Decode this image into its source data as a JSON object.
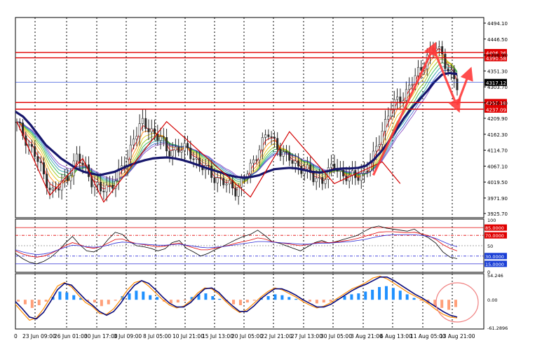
{
  "colors": {
    "background": "#ffffff",
    "grid": "#000000",
    "h_line": "#e00000",
    "h_line_blue": "#1a3fd6",
    "ma_thick": "#16166b",
    "candle": "#2b2b2b",
    "arrow": "#ff3a3a",
    "zigzag": "#d40000",
    "rsi_black": "#000000",
    "rsi_red": "#e00000",
    "rsi_blue": "#2a2ad6",
    "hist_pos": "#1e90ff",
    "hist_neg": "#ffa07a",
    "macd_orange": "#ff8c00",
    "macd_navy": "#0a0a7a",
    "label_blue_bg": "#1a3fd6",
    "label_black_bg": "#000000",
    "label_red_bg": "#e00000"
  },
  "chart_data": [
    {
      "type": "candlestick",
      "panel": "price",
      "yticks": [
        "4494.10",
        "4446.50",
        "4398.90",
        "4351.30",
        "4303.70",
        "4256.10",
        "4209.90",
        "4162.30",
        "4114.70",
        "4067.10",
        "4019.50",
        "3971.90",
        "3925.70"
      ],
      "ylim": [
        3925.7,
        4494.1
      ],
      "close_path": [
        [
          0,
          4190
        ],
        [
          3,
          4150
        ],
        [
          6,
          4100
        ],
        [
          9,
          4040
        ],
        [
          12,
          3990
        ],
        [
          14,
          4000
        ],
        [
          17,
          4040
        ],
        [
          20,
          4090
        ],
        [
          23,
          4060
        ],
        [
          26,
          4010
        ],
        [
          28,
          3990
        ],
        [
          31,
          4010
        ],
        [
          34,
          4040
        ],
        [
          37,
          4090
        ],
        [
          39,
          4160
        ],
        [
          42,
          4190
        ],
        [
          45,
          4175
        ],
        [
          48,
          4150
        ],
        [
          50,
          4110
        ],
        [
          53,
          4120
        ],
        [
          56,
          4115
        ],
        [
          59,
          4100
        ],
        [
          61,
          4070
        ],
        [
          64,
          4050
        ],
        [
          67,
          4030
        ],
        [
          70,
          4010
        ],
        [
          73,
          4000
        ],
        [
          76,
          4030
        ],
        [
          79,
          4080
        ],
        [
          81,
          4130
        ],
        [
          84,
          4160
        ],
        [
          87,
          4130
        ],
        [
          90,
          4090
        ],
        [
          93,
          4075
        ],
        [
          96,
          4060
        ],
        [
          99,
          4030
        ],
        [
          102,
          4030
        ],
        [
          104,
          4045
        ],
        [
          106,
          4070
        ],
        [
          108,
          4050
        ],
        [
          111,
          4030
        ],
        [
          113,
          4035
        ],
        [
          116,
          4050
        ],
        [
          119,
          4090
        ],
        [
          122,
          4180
        ],
        [
          125,
          4240
        ],
        [
          128,
          4270
        ],
        [
          130,
          4290
        ],
        [
          133,
          4330
        ],
        [
          135,
          4360
        ],
        [
          137,
          4400
        ],
        [
          140,
          4420
        ],
        [
          142,
          4400
        ],
        [
          145,
          4340
        ],
        [
          147,
          4300
        ]
      ],
      "n_bars": 148,
      "ma_thick": [
        4230,
        4215,
        4190,
        4160,
        4130,
        4110,
        4090,
        4075,
        4060,
        4050,
        4045,
        4040,
        4045,
        4050,
        4060,
        4070,
        4078,
        4085,
        4090,
        4092,
        4093,
        4090,
        4085,
        4078,
        4070,
        4062,
        4055,
        4048,
        4040,
        4035,
        4032,
        4035,
        4040,
        4050,
        4058,
        4060,
        4062,
        4060,
        4055,
        4050,
        4048,
        4052,
        4058,
        4060,
        4060,
        4062,
        4068,
        4085,
        4110,
        4140,
        4175,
        4210,
        4240,
        4265,
        4290,
        4318,
        4340,
        4345,
        4342
      ],
      "h_lines": [
        {
          "value": 4406.36,
          "label": "4406.36",
          "kind": "red"
        },
        {
          "value": 4390.58,
          "label": "4390.58",
          "kind": "red"
        },
        {
          "value": 4317.12,
          "label": "4317.12",
          "kind": "current"
        },
        {
          "value": 4257.18,
          "label": "4257.18",
          "kind": "red"
        },
        {
          "value": 4237.09,
          "label": "4237.09",
          "kind": "red"
        }
      ],
      "zigzag": [
        [
          0,
          4200
        ],
        [
          11,
          3980
        ],
        [
          22,
          4090
        ],
        [
          29,
          3960
        ],
        [
          50,
          4200
        ],
        [
          78,
          3975
        ],
        [
          91,
          4170
        ],
        [
          106,
          4015
        ],
        [
          122,
          4080
        ],
        [
          128,
          4015
        ]
      ],
      "arrows": [
        {
          "from": [
            119,
            4040
          ],
          "to": [
            139,
            4420
          ]
        },
        {
          "from": [
            139,
            4420
          ],
          "to": [
            147,
            4245
          ]
        },
        {
          "from": [
            147,
            4250
          ],
          "to": [
            151,
            4345
          ]
        }
      ]
    },
    {
      "type": "line",
      "panel": "rsi",
      "ylim": [
        0,
        100
      ],
      "yticks": [
        "100",
        "85.0000",
        "70.0000",
        "50",
        "30.0000",
        "15.0000",
        "0"
      ],
      "levels": [
        {
          "value": 85,
          "label": "85.0000",
          "kind": "red"
        },
        {
          "value": 70,
          "label": "70.0000",
          "kind": "red"
        },
        {
          "value": 50,
          "label": "50",
          "kind": "gray"
        },
        {
          "value": 30,
          "label": "30.0000",
          "kind": "blue"
        },
        {
          "value": 15,
          "label": "15.0000",
          "kind": "blue"
        }
      ],
      "series": [
        {
          "color_key": "rsi_black",
          "values": [
            35,
            25,
            18,
            15,
            20,
            28,
            40,
            55,
            68,
            52,
            40,
            38,
            45,
            62,
            76,
            72,
            58,
            50,
            48,
            45,
            40,
            44,
            56,
            60,
            45,
            38,
            30,
            35,
            42,
            48,
            55,
            62,
            68,
            72,
            80,
            70,
            58,
            55,
            50,
            45,
            40,
            48,
            56,
            60,
            55,
            58,
            62,
            66,
            70,
            78,
            85,
            88,
            84,
            82,
            80,
            78,
            82,
            72,
            65,
            55,
            38,
            28,
            25
          ]
        },
        {
          "color_key": "rsi_red",
          "values": [
            40,
            34,
            30,
            28,
            30,
            35,
            42,
            50,
            56,
            52,
            47,
            45,
            48,
            55,
            62,
            63,
            58,
            54,
            52,
            50,
            48,
            49,
            53,
            55,
            50,
            46,
            42,
            42,
            45,
            48,
            51,
            55,
            58,
            61,
            65,
            63,
            58,
            56,
            54,
            52,
            50,
            52,
            55,
            57,
            56,
            57,
            59,
            61,
            64,
            68,
            72,
            76,
            77,
            77,
            76,
            75,
            76,
            73,
            69,
            62,
            52,
            45,
            40
          ]
        },
        {
          "color_key": "rsi_blue",
          "values": [
            42,
            38,
            35,
            33,
            34,
            37,
            42,
            47,
            51,
            50,
            48,
            47,
            48,
            51,
            55,
            57,
            56,
            54,
            53,
            52,
            51,
            51,
            52,
            53,
            51,
            49,
            47,
            46,
            47,
            48,
            50,
            52,
            54,
            56,
            58,
            58,
            57,
            56,
            55,
            54,
            53,
            53,
            54,
            55,
            55,
            56,
            57,
            58,
            60,
            62,
            65,
            68,
            70,
            71,
            71,
            71,
            71,
            70,
            68,
            64,
            58,
            52,
            48
          ]
        }
      ]
    },
    {
      "type": "bar",
      "panel": "macd",
      "ylim": [
        -61.2896,
        54.246
      ],
      "yticks": [
        "54.246",
        "0.00",
        "-61.2896"
      ],
      "histogram": [
        -4,
        -10,
        -18,
        -12,
        -4,
        6,
        18,
        16,
        10,
        4,
        -4,
        -6,
        -14,
        -10,
        -2,
        8,
        14,
        20,
        18,
        10,
        6,
        -4,
        -8,
        -6,
        -2,
        6,
        12,
        14,
        8,
        2,
        -4,
        -10,
        -12,
        -6,
        -2,
        4,
        8,
        12,
        10,
        6,
        2,
        -2,
        -4,
        -8,
        -6,
        -4,
        2,
        8,
        12,
        14,
        18,
        22,
        28,
        30,
        26,
        20,
        12,
        4,
        -2,
        -8,
        -14,
        -18,
        -22,
        -16
      ],
      "series": [
        {
          "color_key": "macd_orange",
          "values": [
            -10,
            -28,
            -45,
            -40,
            -20,
            5,
            30,
            38,
            28,
            10,
            -6,
            -15,
            -30,
            -32,
            -20,
            0,
            22,
            38,
            42,
            30,
            15,
            0,
            -12,
            -18,
            -14,
            -2,
            15,
            26,
            24,
            12,
            -4,
            -18,
            -28,
            -22,
            -8,
            6,
            18,
            26,
            22,
            14,
            6,
            -4,
            -12,
            -18,
            -14,
            -6,
            4,
            14,
            24,
            30,
            38,
            48,
            52,
            46,
            36,
            26,
            16,
            8,
            0,
            -10,
            -22,
            -32,
            -38,
            -40
          ]
        },
        {
          "color_key": "macd_navy",
          "values": [
            -4,
            -20,
            -38,
            -42,
            -28,
            -4,
            22,
            36,
            32,
            16,
            0,
            -12,
            -26,
            -34,
            -26,
            -8,
            14,
            32,
            42,
            36,
            22,
            6,
            -8,
            -16,
            -16,
            -6,
            10,
            24,
            26,
            16,
            0,
            -14,
            -26,
            -26,
            -14,
            2,
            14,
            24,
            24,
            18,
            10,
            0,
            -8,
            -16,
            -16,
            -10,
            0,
            10,
            20,
            28,
            34,
            42,
            50,
            50,
            42,
            32,
            22,
            12,
            4,
            -6,
            -16,
            -26,
            -34,
            -38
          ]
        }
      ],
      "annotation": "circle"
    }
  ],
  "x_axis": {
    "ticks": [
      "0",
      "23 Jun 09:00",
      "26 Jun 01:00",
      "30 Jun 17:00",
      "3 Jul 09:00",
      "8 Jul 05:00",
      "10 Jul 21:00",
      "15 Jul 13:00",
      "20 Jul 05:00",
      "22 Jul 21:00",
      "27 Jul 13:00",
      "30 Jul 05:00",
      "3 Aug 21:00",
      "6 Aug 13:00",
      "11 Aug 05:00",
      "13 Aug 21:00"
    ]
  }
}
